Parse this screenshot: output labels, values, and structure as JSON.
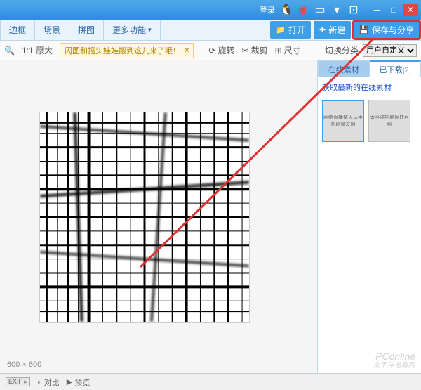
{
  "titlebar": {
    "login": "登录"
  },
  "maintabs": {
    "t1": "边框",
    "t2": "场景",
    "t3": "拼图",
    "t4": "更多功能",
    "open": "打开",
    "new": "新建",
    "save": "保存与分享"
  },
  "toolbar": {
    "zoom": "1:1 原大",
    "notice": "闪图和摇头娃娃搬到这儿来了哦！",
    "rotate": "旋转",
    "crop": "裁剪",
    "size": "尺寸",
    "catlabel": "切换分类",
    "catvalue": "用户自定义"
  },
  "side": {
    "tab_online": "在线素材",
    "tab_downloaded": "已下载[2]",
    "link": "获取最新的在线素材",
    "thumb1": "网络直播整天玩手机刷微友圈",
    "thumb2": "太平洋电脑网IT百科"
  },
  "status": {
    "dim": "600 × 600",
    "exif": "EXIF ▸",
    "compare": "对比",
    "preview": "预览"
  },
  "watermark": {
    "main": "PConline",
    "sub": "太平洋电脑网"
  }
}
